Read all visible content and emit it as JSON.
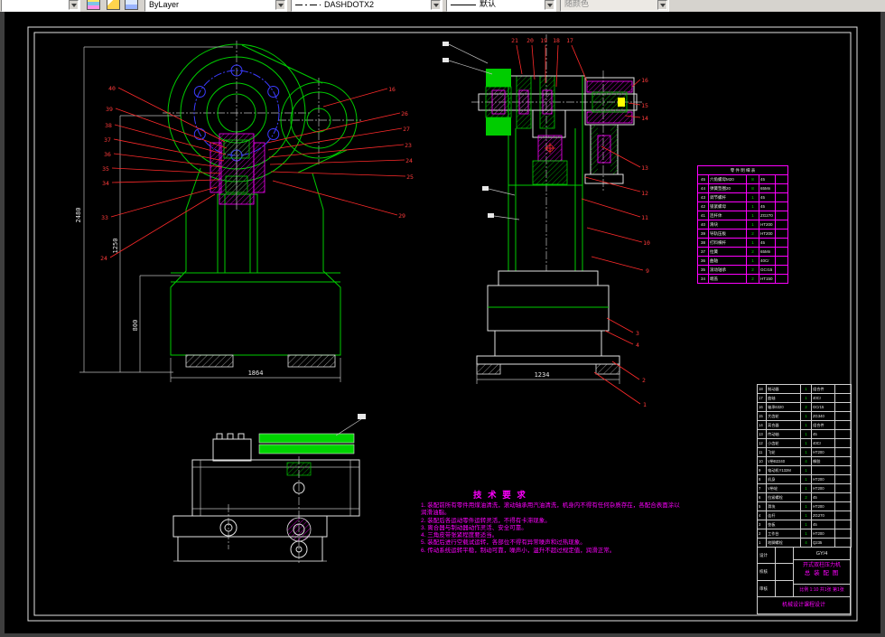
{
  "toolbar": {
    "layer_value": "",
    "color_value": "ByLayer",
    "linetype_value": "DASHDOTX2",
    "lineweight_value": "默认",
    "plotstyle_value": "随颜色",
    "icons": [
      "layers-icon",
      "make-object-layer-current-icon",
      "layer-states-icon"
    ]
  },
  "colors": {
    "line_green": "#00cc00",
    "detail_magenta": "#ff00ff",
    "leader_red": "#ff2a2a",
    "dim_white": "#e8e8e8",
    "bolt_blue": "#3c3cff"
  },
  "front_view": {
    "dims": {
      "total_height": "2480",
      "mid_height": "1250",
      "table_height": "800",
      "base_width": "1864"
    },
    "callouts_left": [
      "40",
      "39",
      "38",
      "37",
      "36",
      "35",
      "34",
      "33",
      "24"
    ],
    "callouts_right": [
      "16",
      "26",
      "27",
      "23",
      "24",
      "25",
      "29"
    ]
  },
  "section_view": {
    "dims": {
      "base_width": "1234"
    },
    "callouts_top": [
      "21",
      "20",
      "19",
      "18",
      "17"
    ],
    "callouts_right": [
      "16",
      "15",
      "14",
      "13",
      "12",
      "11",
      "10",
      "9"
    ],
    "callouts_bottom": [
      "3",
      "4",
      "2",
      "1"
    ]
  },
  "notes": {
    "title": "技 术 要 求",
    "lines": [
      "1. 装配前所有零件用煤油清洗，滚动轴承用汽油清洗，机身内不得有任何杂质存在，各配合表面涂以润滑油脂。",
      "2. 装配后各运动零件运转灵活，不得有卡滞现象。",
      "3. 离合器与制动器动作灵活、安全可靠。",
      "4. 三角皮带张紧程度要适当。",
      "5. 装配后进行空载试运转，各部位不得有异常噪声和过热现象。",
      "6. 传动系统运转平稳，制动可靠，噪声小，温升不超过规定值，润滑正常。"
    ]
  },
  "parts_table": {
    "title": "零 件 明 细 表",
    "rows": [
      [
        "45",
        "六角螺母M20",
        "8",
        "45",
        ""
      ],
      [
        "44",
        "弹簧垫圈20",
        "8",
        "65Mn",
        ""
      ],
      [
        "43",
        "调节螺杆",
        "1",
        "45",
        ""
      ],
      [
        "42",
        "锁紧螺母",
        "1",
        "45",
        ""
      ],
      [
        "41",
        "连杆体",
        "1",
        "ZG270",
        ""
      ],
      [
        "40",
        "滑块",
        "1",
        "HT200",
        ""
      ],
      [
        "39",
        "导轨压板",
        "2",
        "HT200",
        ""
      ],
      [
        "38",
        "打料横杆",
        "1",
        "45",
        ""
      ],
      [
        "37",
        "拉簧",
        "2",
        "65Mn",
        ""
      ],
      [
        "36",
        "曲轴",
        "1",
        "40Cr",
        ""
      ],
      [
        "35",
        "滚动轴承",
        "2",
        "GCr15",
        ""
      ],
      [
        "34",
        "端盖",
        "2",
        "HT150",
        ""
      ]
    ]
  },
  "bom_strip": {
    "rows": [
      [
        "18",
        "制动器",
        "1",
        "组合件",
        ""
      ],
      [
        "17",
        "曲轴",
        "1",
        "40Cr",
        ""
      ],
      [
        "16",
        "轴承6320",
        "2",
        "GCr15",
        ""
      ],
      [
        "15",
        "大齿轮",
        "1",
        "ZG340",
        ""
      ],
      [
        "14",
        "离合器",
        "1",
        "组合件",
        ""
      ],
      [
        "13",
        "传动轴",
        "1",
        "45",
        ""
      ],
      [
        "12",
        "小齿轮",
        "1",
        "40Cr",
        ""
      ],
      [
        "11",
        "飞轮",
        "1",
        "HT200",
        ""
      ],
      [
        "10",
        "V带B2240",
        "4",
        "橡胶",
        ""
      ],
      [
        "9",
        "电动机Y132M",
        "1",
        "",
        ""
      ],
      [
        "8",
        "机身",
        "1",
        "HT200",
        ""
      ],
      [
        "7",
        "V带轮",
        "1",
        "HT200",
        ""
      ],
      [
        "6",
        "拉紧螺栓",
        "2",
        "45",
        ""
      ],
      [
        "5",
        "滑块",
        "1",
        "HT200",
        ""
      ],
      [
        "4",
        "连杆",
        "1",
        "ZG270",
        ""
      ],
      [
        "3",
        "垫板",
        "1",
        "45",
        ""
      ],
      [
        "2",
        "工作台",
        "1",
        "HT200",
        ""
      ],
      [
        "1",
        "地脚螺栓",
        "4",
        "Q235",
        ""
      ]
    ]
  },
  "title_block": {
    "design_label": "设计",
    "check_label": "校核",
    "audit_label": "审核",
    "std": "GY/4",
    "title1": "开式双柱压力机",
    "title2": "总 装 配 图",
    "scale_text": "比例 1:10  共1张 第1张",
    "org": "机械设计课程设计"
  }
}
